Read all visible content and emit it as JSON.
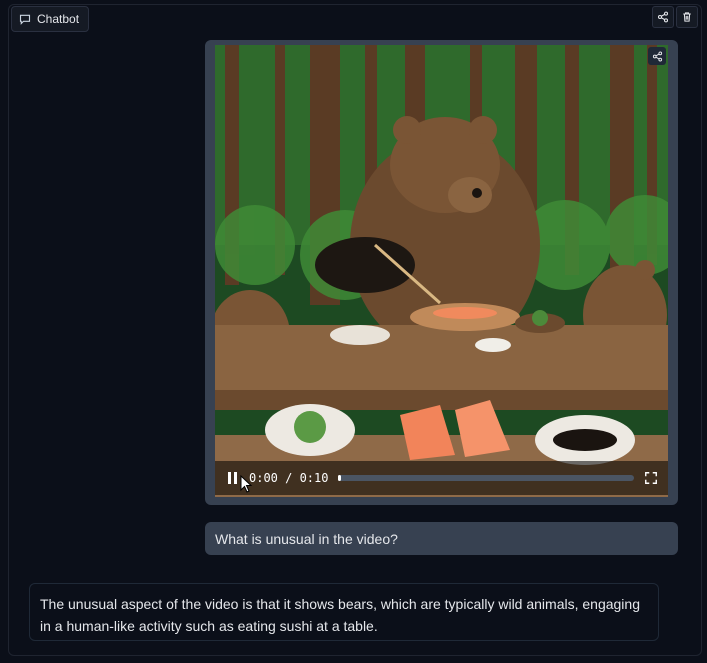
{
  "header": {
    "label": "Chatbot",
    "label_icon": "chat-bubble-icon",
    "actions": [
      {
        "name": "share",
        "icon": "share-icon"
      },
      {
        "name": "delete",
        "icon": "trash-icon"
      }
    ]
  },
  "video": {
    "current_time": "0:00",
    "duration": "0:10",
    "time_display": "0:00 / 0:10",
    "progress": 0.0,
    "state": "playing",
    "share_icon": "share-icon",
    "fullscreen_icon": "fullscreen-icon"
  },
  "messages": [
    {
      "role": "user",
      "text": "What is unusual in the video?"
    },
    {
      "role": "bot",
      "text": "The unusual aspect of the video is that it shows bears, which are typically wild animals, engaging in a human-like activity such as eating sushi at a table."
    }
  ],
  "colors": {
    "background": "#0b0f19",
    "user_bubble": "#374151",
    "border": "#1f2937"
  }
}
